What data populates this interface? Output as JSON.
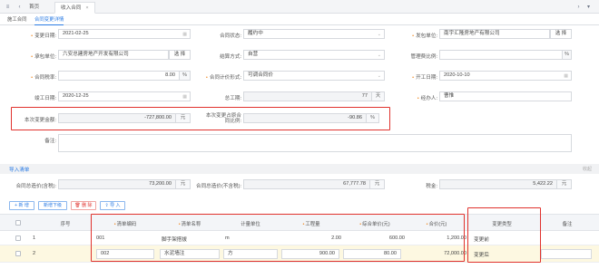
{
  "nav": {
    "tabs": [
      {
        "label": "首页"
      },
      {
        "label": "收入合同"
      }
    ]
  },
  "subtabs": [
    "施工合同",
    "合同变更详情"
  ],
  "form": {
    "change_date_label": "变更日期:",
    "change_date_value": "2021-02-25",
    "contract_status_label": "合同状态:",
    "contract_status_value": "履约中",
    "issuer_label": "发包单位:",
    "issuer_value": "南宇汇隆房地产有限公司",
    "select_label": "选 择",
    "contractor_label": "承包单位:",
    "contractor_value": "六安总建房地产开发有限公司",
    "settlement_label": "结算方式:",
    "settlement_value": "自营",
    "mgmt_ratio_label": "管理费比例:",
    "mgmt_ratio_value": "",
    "tax_rate_label": "合同税率:",
    "tax_rate_value": "8.00",
    "pricing_label": "合同计价形式:",
    "pricing_value": "可调合同价",
    "start_date_label": "开工日期:",
    "start_date_value": "2020-10-10",
    "finish_date_label": "竣工日期:",
    "finish_date_value": "2020-12-25",
    "total_days_label": "总工期:",
    "total_days_value": "77",
    "days_unit": "天",
    "operator_label": "经办人:",
    "operator_value": "曹惟",
    "change_amount_label": "本次变更金额:",
    "change_amount_value": "-727,800.00",
    "change_ratio_label": "本次变更占原合同比例:",
    "change_ratio_value": "-90.86",
    "remark_label": "备注:",
    "remark_value": "",
    "yuan": "元",
    "percent": "%",
    "cal_icon": "calendar-icon",
    "caret_icon": "chevron-down-icon"
  },
  "section": {
    "title": "导入清单",
    "collapse_label": "收起"
  },
  "totals": {
    "with_tax_label": "合同总造价(含税):",
    "with_tax_value": "73,200.00",
    "without_tax_label": "合同总造价(不含税):",
    "without_tax_value": "67,777.78",
    "tax_label": "税金:",
    "tax_value": "5,422.22"
  },
  "toolbar": {
    "add": "+ 新 增",
    "add_below": "新增下级",
    "delete": "删 除",
    "import": "导 入"
  },
  "table": {
    "headers": [
      "序号",
      "清单编码",
      "清单名称",
      "计量单位",
      "工程量",
      "综合单价(元)",
      "合价(元)",
      "变更类型",
      "备注"
    ],
    "rows": [
      {
        "no": "1",
        "code": "001",
        "name": "脚手架搭拔",
        "unit": "m",
        "qty": "2.00",
        "price": "600.00",
        "total": "1,200.00",
        "type": "变更前",
        "remark": ""
      },
      {
        "no": "2",
        "code": "002",
        "name": "水泥墙注",
        "unit": "方",
        "qty": "900.00",
        "price": "80.00",
        "total": "72,000.00",
        "type": "变更后",
        "remark": ""
      }
    ]
  },
  "colors": {
    "accent": "#2a7be4",
    "required": "#f08a24",
    "highlight_box": "#e0322d",
    "selected_row": "#fdf8e1"
  }
}
